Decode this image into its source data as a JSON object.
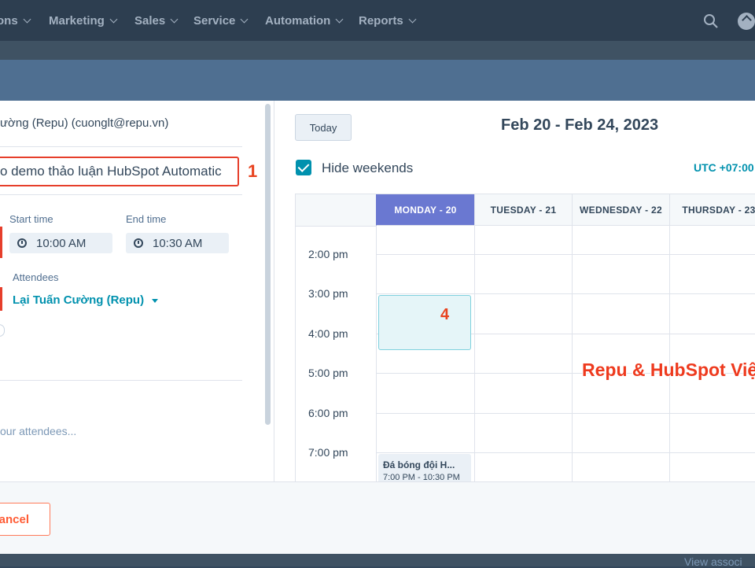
{
  "nav": {
    "items": [
      {
        "label": "ons",
        "name": "nav-item-conversations"
      },
      {
        "label": "Marketing",
        "name": "nav-item-marketing"
      },
      {
        "label": "Sales",
        "name": "nav-item-sales"
      },
      {
        "label": "Service",
        "name": "nav-item-service"
      },
      {
        "label": "Automation",
        "name": "nav-item-automation"
      },
      {
        "label": "Reports",
        "name": "nav-item-reports"
      }
    ],
    "icons": [
      "search-icon",
      "upgrade-icon"
    ]
  },
  "meeting_form": {
    "from": "ường (Repu) (cuonglt@repu.vn)",
    "title_value": "o demo thảo luận HubSpot Automatic",
    "title_badge": "1",
    "start_label": "Start time",
    "start_value": "10:00 AM",
    "end_label": "End time",
    "end_value": "10:30 AM",
    "attendees_label": "Attendees",
    "attendee_value": "Lại Tuấn Cường (Repu)",
    "description_placeholder": "our attendees..."
  },
  "calendar": {
    "today_label": "Today",
    "range_title": "Feb 20 - Feb 24, 2023",
    "hide_weekends_label": "Hide weekends",
    "hide_weekends_checked": true,
    "timezone": "UTC +07:00",
    "days": [
      "MONDAY - 20",
      "TUESDAY - 21",
      "WEDNESDAY - 22",
      "THURSDAY - 23"
    ],
    "active_day_index": 0,
    "times": [
      "2:00 pm",
      "3:00 pm",
      "4:00 pm",
      "5:00 pm",
      "6:00 pm",
      "7:00 pm"
    ],
    "slot_badge": "4",
    "overlay_text": "Repu & HubSpot Việt",
    "event": {
      "title": "Đá bóng đội H...",
      "time": "7:00 PM - 10:30 PM"
    }
  },
  "footer": {
    "cancel_label": "ancel",
    "view_associations": "View associ"
  },
  "colors": {
    "accent": "#0091ae",
    "active_day": "#6a78d1",
    "annotation": "#e8431f",
    "nav_bg": "#2d3e50"
  }
}
